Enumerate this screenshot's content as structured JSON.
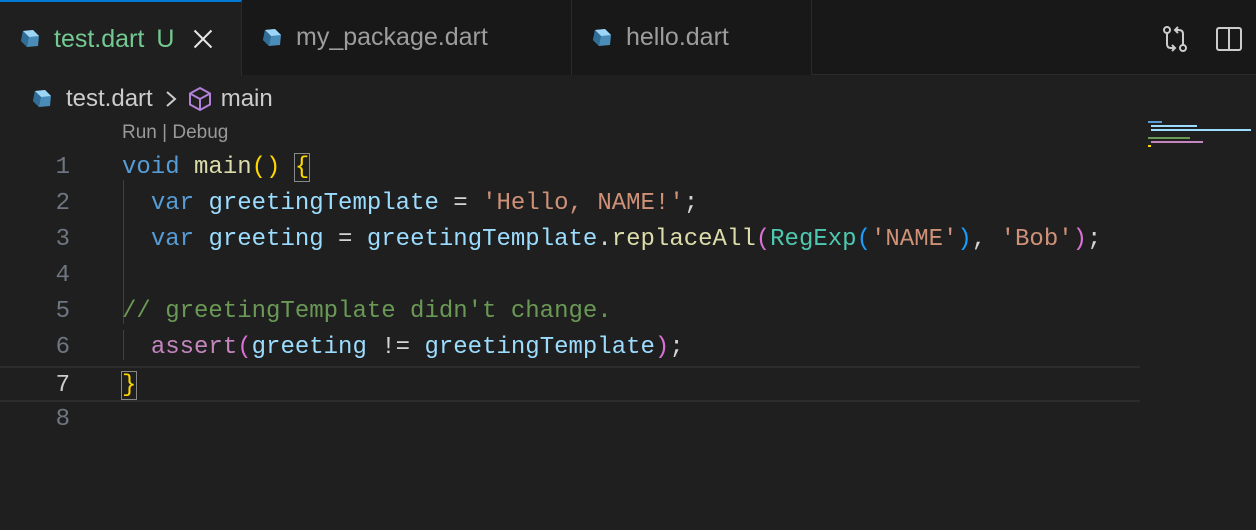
{
  "tabs": [
    {
      "label": "test.dart",
      "badge": "U",
      "active": true
    },
    {
      "label": "my_package.dart",
      "active": false
    },
    {
      "label": "hello.dart",
      "active": false
    }
  ],
  "breadcrumb": {
    "file": "test.dart",
    "symbol": "main"
  },
  "codelens": {
    "run": "Run",
    "separator": " | ",
    "debug": "Debug"
  },
  "editor": {
    "line_numbers": [
      "1",
      "2",
      "3",
      "4",
      "5",
      "6",
      "7",
      "8"
    ],
    "current_line": 7,
    "tokens": {
      "l1_void": "void",
      "l1_main": "main",
      "l1_parens": "()",
      "l1_brace": "{",
      "l2_var": "var",
      "l2_name": "greetingTemplate",
      "l2_eq": " = ",
      "l2_str": "'Hello, NAME!'",
      "l2_semi": ";",
      "l3_var": "var",
      "l3_name": "greeting",
      "l3_eq": " = ",
      "l3_obj": "greetingTemplate",
      "l3_dot": ".",
      "l3_method": "replaceAll",
      "l3_open": "(",
      "l3_type": "RegExp",
      "l3_open2": "(",
      "l3_str1": "'NAME'",
      "l3_close2": ")",
      "l3_comma": ", ",
      "l3_str2": "'Bob'",
      "l3_close": ")",
      "l3_semi": ";",
      "l5_comment": "// greetingTemplate didn't change.",
      "l6_assert": "assert",
      "l6_open": "(",
      "l6_a": "greeting",
      "l6_op": " != ",
      "l6_b": "greetingTemplate",
      "l6_close": ")",
      "l6_semi": ";",
      "l7_brace": "}"
    }
  },
  "icons": {
    "file": "dart-icon",
    "close": "close-icon",
    "compare": "open-changes-icon",
    "split": "split-editor-icon",
    "chevron": "chevron-right-icon",
    "symbol": "method-cube-icon"
  },
  "colors": {
    "background": "#1f1f1f",
    "tab_active_border": "#0078d4",
    "untracked": "#73c991",
    "keyword": "#569cd6",
    "string": "#ce9178"
  }
}
